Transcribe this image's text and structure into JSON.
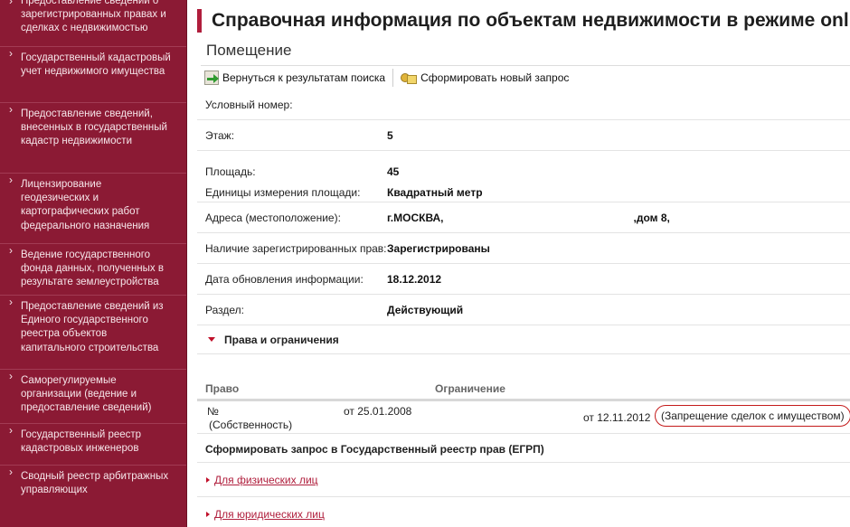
{
  "sidebar": {
    "items": [
      {
        "label": "Предоставление сведений о зарегистрированных правах и сделках с недвижимостью"
      },
      {
        "label": "Государственный кадастровый учет недвижимого имущества"
      },
      {
        "label": "Предоставление сведений, внесенных в государственный кадастр недвижимости"
      },
      {
        "label": "Лицензирование геодезических и картографических работ федерального назначения"
      },
      {
        "label": "Ведение государственного фонда данных, полученных в результате землеустройства"
      },
      {
        "label": "Предоставление сведений из Единого государственного реестра объектов капитального строительства"
      },
      {
        "label": "Саморегулируемые организации (ведение и предоставление сведений)"
      },
      {
        "label": "Государственный реестр кадастровых инженеров"
      },
      {
        "label": "Сводный реестр арбитражных управляющих"
      }
    ]
  },
  "page": {
    "title": "Справочная информация по объектам недвижимости в режиме online",
    "subtitle": "Помещение"
  },
  "toolbar": {
    "back_label": "Вернуться к результатам поиска",
    "new_request_label": "Сформировать новый запрос"
  },
  "info": {
    "cadastral_label": "Условный номер:",
    "floor_label": "Этаж:",
    "floor_value": "5",
    "area_label": "Площадь:",
    "area_value": "45",
    "unit_label": "Единицы измерения площади:",
    "unit_value": "Квадратный метр",
    "address_label": "Адреса (местоположение):",
    "address_city": "г.МОСКВА,",
    "address_house": ",дом 8,",
    "rights_label": "Наличие зарегистрированных прав:",
    "rights_value": "Зарегистрированы",
    "updated_label": "Дата обновления информации:",
    "updated_value": "18.12.2012",
    "section_label": "Раздел:",
    "section_value": "Действующий"
  },
  "rights_section": {
    "header": "Права и ограничения",
    "col_right": "Право",
    "col_restriction": "Ограничение",
    "row": {
      "number": "№",
      "kind": "(Собственность)",
      "right_date": "от 25.01.2008",
      "restriction_date": "от 12.11.2012",
      "restriction": "(Запрещение сделок с имуществом)"
    }
  },
  "request": {
    "title": "Сформировать запрос в Государственный реестр прав (ЕГРП)",
    "link_individuals": "Для физических лиц",
    "link_legal": "Для юридических лиц"
  },
  "colors": {
    "sidebar_bg": "#8b1a34",
    "accent": "#b01e3c",
    "highlight": "#c41a1a"
  }
}
